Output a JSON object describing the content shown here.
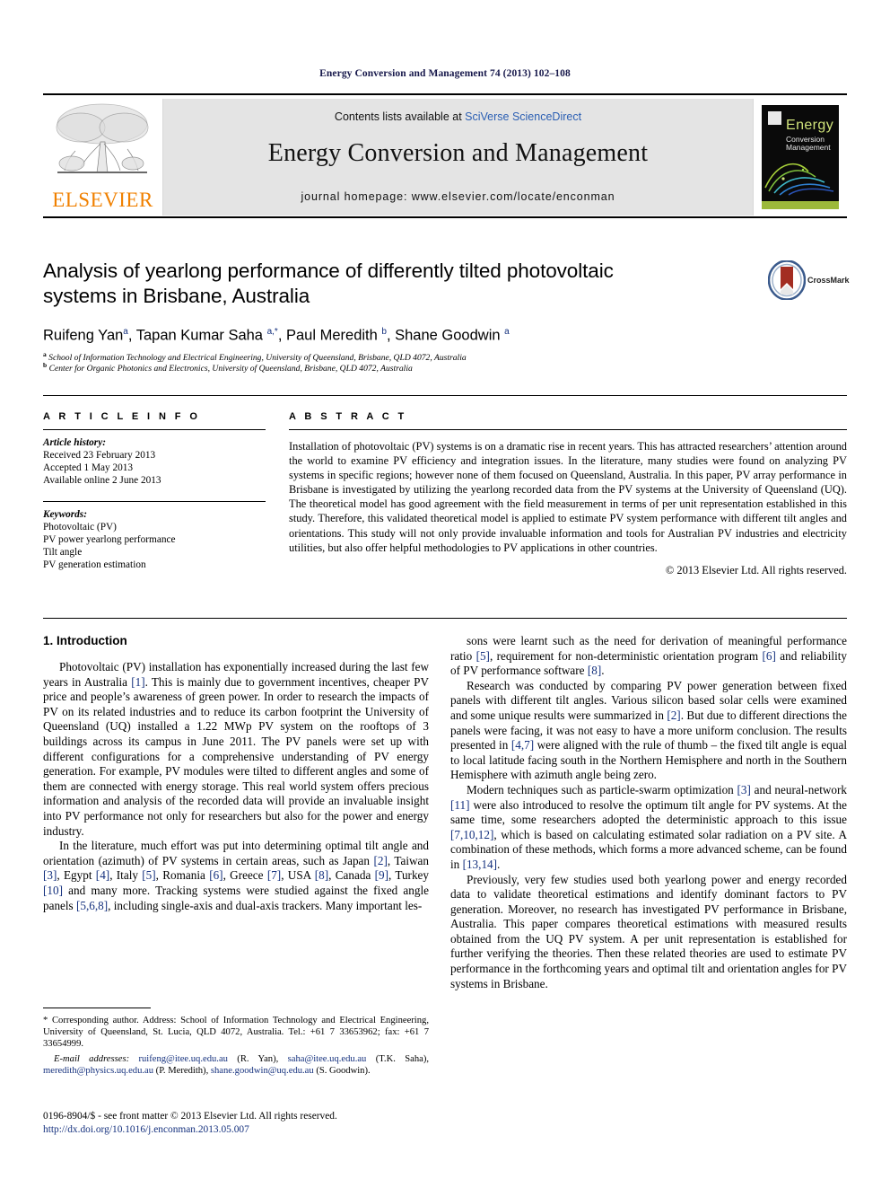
{
  "running_head": "Energy Conversion and Management 74 (2013) 102–108",
  "masthead": {
    "publisher_name": "ELSEVIER",
    "contents_prefix": "Contents lists available at ",
    "contents_link": "SciVerse ScienceDirect",
    "journal_title": "Energy Conversion and Management",
    "homepage": "journal homepage: www.elsevier.com/locate/enconman",
    "cover": {
      "title": "Energy",
      "sub1": "Conversion",
      "sub2": "Management"
    }
  },
  "article": {
    "title": "Analysis of yearlong performance of differently tilted photovoltaic systems in Brisbane, Australia",
    "crossmark_label": "CrossMark",
    "authors_html": "Ruifeng Yan<sup>a</sup>, Tapan Kumar Saha <sup>a,<span class=\"star\">*</span></sup>, Paul Meredith <sup>b</sup>, Shane Goodwin <sup>a</sup>",
    "affiliation_a": "School of Information Technology and Electrical Engineering, University of Queensland, Brisbane, QLD 4072, Australia",
    "affiliation_b": "Center for Organic Photonics and Electronics, University of Queensland, Brisbane, QLD 4072, Australia"
  },
  "article_info": {
    "heading": "A R T I C L E   I N F O",
    "history_label": "Article history:",
    "history": [
      "Received 23 February 2013",
      "Accepted 1 May 2013",
      "Available online 2 June 2013"
    ],
    "keywords_label": "Keywords:",
    "keywords": [
      "Photovoltaic (PV)",
      "PV power yearlong performance",
      "Tilt angle",
      "PV generation estimation"
    ]
  },
  "abstract": {
    "heading": "A B S T R A C T",
    "text": "Installation of photovoltaic (PV) systems is on a dramatic rise in recent years. This has attracted researchers’ attention around the world to examine PV efficiency and integration issues. In the literature, many studies were found on analyzing PV systems in specific regions; however none of them focused on Queensland, Australia. In this paper, PV array performance in Brisbane is investigated by utilizing the yearlong recorded data from the PV systems at the University of Queensland (UQ). The theoretical model has good agreement with the field measurement in terms of per unit representation established in this study. Therefore, this validated theoretical model is applied to estimate PV system performance with different tilt angles and orientations. This study will not only provide invaluable information and tools for Australian PV industries and electricity utilities, but also offer helpful methodologies to PV applications in other countries.",
    "copyright": "© 2013 Elsevier Ltd. All rights reserved."
  },
  "body": {
    "section_heading": "1. Introduction",
    "left_paragraphs_html": [
      "Photovoltaic (PV) installation has exponentially increased during the last few years in Australia <span class=\"ref\">[1]</span>. This is mainly due to government incentives, cheaper PV price and people’s awareness of green power. In order to research the impacts of PV on its related industries and to reduce its carbon footprint the University of Queensland (UQ) installed a 1.22 MWp PV system on the rooftops of 3 buildings across its campus in June 2011. The PV panels were set up with different configurations for a comprehensive understanding of PV energy generation. For example, PV modules were tilted to different angles and some of them are connected with energy storage. This real world system offers precious information and analysis of the recorded data will provide an invaluable insight into PV performance not only for researchers but also for the power and energy industry.",
      "In the literature, much effort was put into determining optimal tilt angle and orientation (azimuth) of PV systems in certain areas, such as Japan <span class=\"ref\">[2]</span>, Taiwan <span class=\"ref\">[3]</span>, Egypt <span class=\"ref\">[4]</span>, Italy <span class=\"ref\">[5]</span>, Romania <span class=\"ref\">[6]</span>, Greece <span class=\"ref\">[7]</span>, USA <span class=\"ref\">[8]</span>, Canada <span class=\"ref\">[9]</span>, Turkey <span class=\"ref\">[10]</span> and many more. Tracking systems were studied against the fixed angle panels <span class=\"ref\">[5,6,8]</span>, including single-axis and dual-axis trackers. Many important les-"
    ],
    "right_paragraphs_html": [
      "sons were learnt such as the need for derivation of meaningful performance ratio <span class=\"ref\">[5]</span>, requirement for non-deterministic orientation program <span class=\"ref\">[6]</span> and reliability of PV performance software <span class=\"ref\">[8]</span>.",
      "Research was conducted by comparing PV power generation between fixed panels with different tilt angles. Various silicon based solar cells were examined and some unique results were summarized in <span class=\"ref\">[2]</span>. But due to different directions the panels were facing, it was not easy to have a more uniform conclusion. The results presented in <span class=\"ref\">[4,7]</span> were aligned with the rule of thumb – the fixed tilt angle is equal to local latitude facing south in the Northern Hemisphere and north in the Southern Hemisphere with azimuth angle being zero.",
      "Modern techniques such as particle-swarm optimization <span class=\"ref\">[3]</span> and neural-network <span class=\"ref\">[11]</span> were also introduced to resolve the optimum tilt angle for PV systems. At the same time, some researchers adopted the deterministic approach to this issue <span class=\"ref\">[7,10,12]</span>, which is based on calculating estimated solar radiation on a PV site. A combination of these methods, which forms a more advanced scheme, can be found in <span class=\"ref\">[13,14]</span>.",
      "Previously, very few studies used both yearlong power and energy recorded data to validate theoretical estimations and identify dominant factors to PV generation. Moreover, no research has investigated PV performance in Brisbane, Australia. This paper compares theoretical estimations with measured results obtained from the UQ PV system. A per unit representation is established for further verifying the theories. Then these related theories are used to estimate PV performance in the forthcoming years and optimal tilt and orientation angles for PV systems in Brisbane."
    ]
  },
  "footnote": {
    "corresponding_html": "<span class=\"star\">*</span> Corresponding author. Address: School of Information Technology and Electrical Engineering, University of Queensland, St. Lucia, QLD 4072, Australia. Tel.: +61 7 33653962; fax: +61 7 33654999.",
    "emails_html": "<em>E-mail addresses:</em> <span class=\"mail\">ruifeng@itee.uq.edu.au</span> (R. Yan), <span class=\"mail\">saha@itee.uq.edu.au</span> (T.K. Saha), <span class=\"mail\">meredith@physics.uq.edu.au</span> (P. Meredith), <span class=\"mail\">shane.goodwin@uq.edu.au</span> (S. Goodwin)."
  },
  "frontmatter": {
    "issn_line": "0196-8904/$ - see front matter © 2013 Elsevier Ltd. All rights reserved.",
    "doi": "http://dx.doi.org/10.1016/j.enconman.2013.05.007"
  }
}
